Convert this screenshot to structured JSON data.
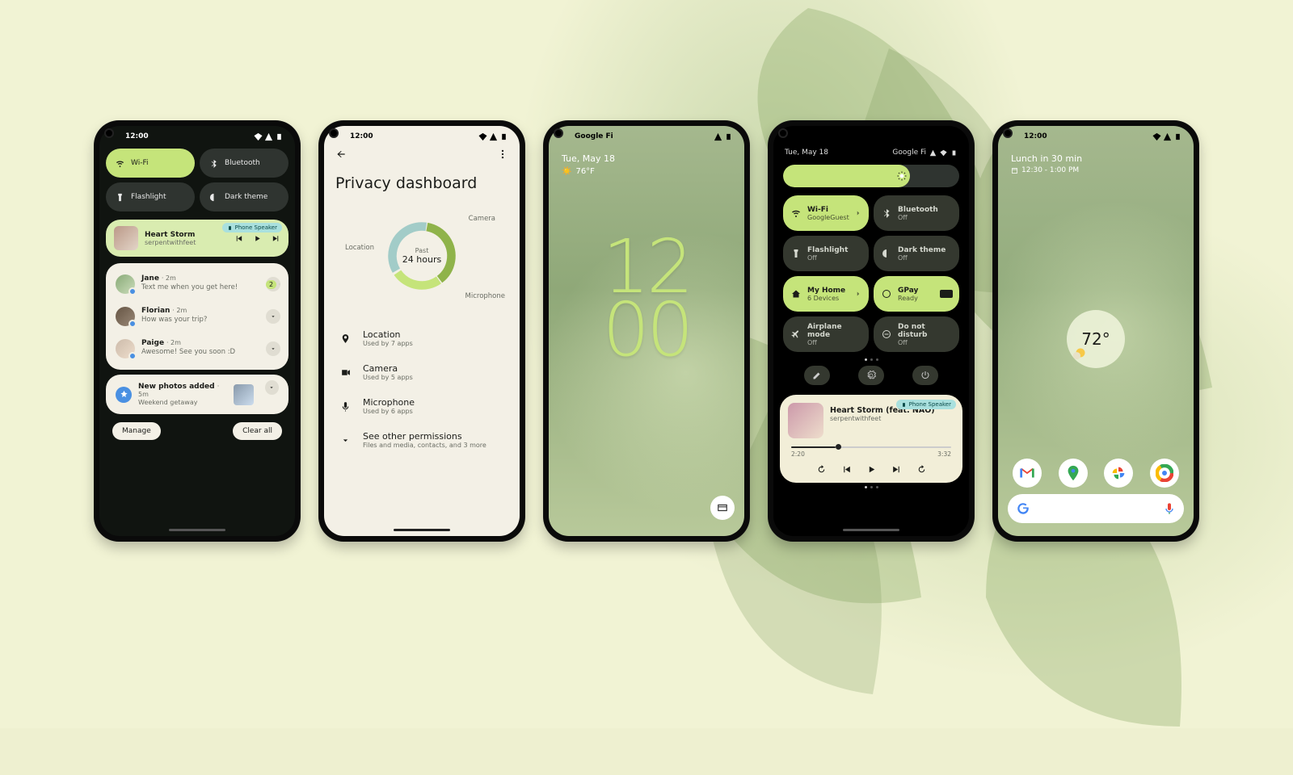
{
  "common": {
    "clock": "12:00"
  },
  "p1": {
    "qs": {
      "wifi": "Wi-Fi",
      "bt": "Bluetooth",
      "flash": "Flashlight",
      "dark": "Dark theme"
    },
    "media": {
      "title": "Heart Storm",
      "artist": "serpentwithfeet",
      "badge": "Phone Speaker"
    },
    "n1": {
      "name": "Jane",
      "when": "· 2m",
      "msg": "Text me when you get here!",
      "badge": "2"
    },
    "n2": {
      "name": "Florian",
      "when": "· 2m",
      "msg": "How was your trip?"
    },
    "n3": {
      "name": "Paige",
      "when": "· 2m",
      "msg": "Awesome! See you soon :D"
    },
    "photos": {
      "title": "New photos added",
      "when": "· 5m",
      "sub": "Weekend getaway"
    },
    "manage": "Manage",
    "clear": "Clear all"
  },
  "p2": {
    "title": "Privacy dashboard",
    "center1": "Past",
    "center2": "24 hours",
    "labels": {
      "loc": "Location",
      "cam": "Camera",
      "mic": "Microphone"
    },
    "rows": {
      "loc_t": "Location",
      "loc_s": "Used by 7 apps",
      "cam_t": "Camera",
      "cam_s": "Used by 5 apps",
      "mic_t": "Microphone",
      "mic_s": "Used by 6 apps",
      "more_t": "See other permissions",
      "more_s": "Files and media, contacts, and 3 more"
    }
  },
  "p3": {
    "carrier": "Google Fi",
    "date": "Tue, May 18",
    "temp": "76°F",
    "hh": "12",
    "mm": "00"
  },
  "p4": {
    "date": "Tue, May 18",
    "carrier": "Google Fi",
    "tiles": {
      "wifi_t": "Wi-Fi",
      "wifi_s": "GoogleGuest",
      "bt_t": "Bluetooth",
      "bt_s": "Off",
      "flash_t": "Flashlight",
      "flash_s": "Off",
      "dark_t": "Dark theme",
      "dark_s": "Off",
      "home_t": "My Home",
      "home_s": "6 Devices",
      "gpay_t": "GPay",
      "gpay_s": "Ready",
      "air_t": "Airplane mode",
      "air_s": "Off",
      "dnd_t": "Do not disturb",
      "dnd_s": "Off"
    },
    "media": {
      "title": "Heart Storm (feat. NAO)",
      "artist": "serpentwithfeet",
      "badge": "Phone Speaker",
      "elapsed": "2:20",
      "total": "3:32"
    }
  },
  "p5": {
    "glance1": "Lunch in 30 min",
    "glance2": "12:30 - 1:00 PM",
    "temp": "72°"
  }
}
